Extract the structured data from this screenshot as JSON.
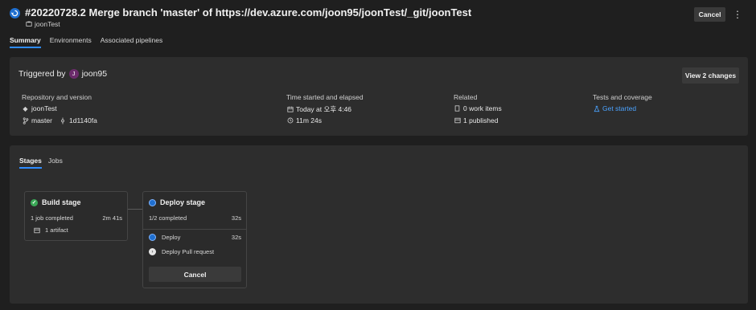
{
  "header": {
    "title": "#20220728.2 Merge branch 'master' of https://dev.azure.com/joon95/joonTest/_git/joonTest",
    "repo": "joonTest",
    "cancel_label": "Cancel",
    "more_label": "⋮"
  },
  "tabs": [
    {
      "label": "Summary",
      "active": true
    },
    {
      "label": "Environments",
      "active": false
    },
    {
      "label": "Associated pipelines",
      "active": false
    }
  ],
  "summary": {
    "triggered_by_label": "Triggered by",
    "user_initial": "J",
    "user_name": "joon95",
    "view_changes_label": "View 2 changes",
    "repository": {
      "heading": "Repository and version",
      "repo": "joonTest",
      "branch": "master",
      "commit": "1d1140fa"
    },
    "time": {
      "heading": "Time started and elapsed",
      "started": "Today at 오후 4:46",
      "elapsed": "11m 24s"
    },
    "related": {
      "heading": "Related",
      "work_items": "0 work items",
      "published": "1 published"
    },
    "tests": {
      "heading": "Tests and coverage",
      "link": "Get started"
    }
  },
  "stages_tabs": [
    {
      "label": "Stages",
      "active": true
    },
    {
      "label": "Jobs",
      "active": false
    }
  ],
  "stages": {
    "build": {
      "title": "Build stage",
      "status": "1 job completed",
      "duration": "2m 41s",
      "artifact": "1 artifact"
    },
    "deploy": {
      "title": "Deploy stage",
      "status": "1/2 completed",
      "duration": "32s",
      "jobs": [
        {
          "name": "Deploy",
          "duration": "32s"
        },
        {
          "name": "Deploy Pull request",
          "duration": ""
        }
      ],
      "cancel_label": "Cancel"
    }
  },
  "colors": {
    "accent": "#2f8cff",
    "success": "#3aa856",
    "running": "#1f6fd0",
    "background": "#1f1f1f",
    "card": "#2d2d2d"
  }
}
